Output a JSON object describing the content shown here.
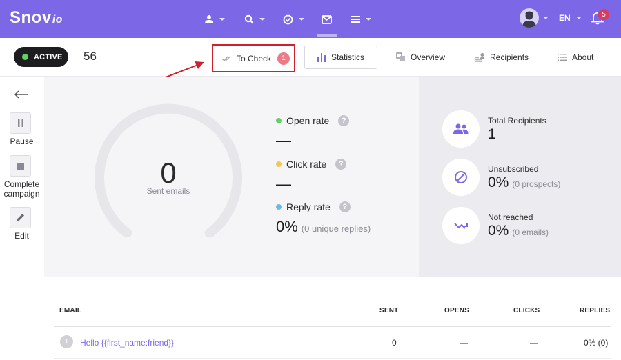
{
  "app": {
    "logo_main": "Snov",
    "logo_suffix": "io"
  },
  "topnav": {
    "items": [
      {
        "icon": "user-icon"
      },
      {
        "icon": "search-icon"
      },
      {
        "icon": "check-circle-icon"
      },
      {
        "icon": "mail-icon"
      },
      {
        "icon": "menu-icon"
      }
    ],
    "language": "EN",
    "notifications_count": "5"
  },
  "campaign": {
    "status": "ACTIVE",
    "name": "56"
  },
  "tabs": {
    "to_check": "To Check",
    "to_check_count": "1",
    "statistics": "Statistics",
    "overview": "Overview",
    "recipients": "Recipients",
    "about": "About"
  },
  "sidebar": {
    "pause": "Pause",
    "complete_line1": "Complete",
    "complete_line2": "campaign",
    "edit": "Edit"
  },
  "stats": {
    "sent_emails_value": "0",
    "sent_emails_label": "Sent emails",
    "open_rate_label": "Open rate",
    "open_rate_value": "—",
    "click_rate_label": "Click rate",
    "click_rate_value": "—",
    "reply_rate_label": "Reply rate",
    "reply_rate_value": "0%",
    "reply_rate_sub": "(0 unique replies)",
    "question_mark": "?",
    "colors": {
      "open": "#5fd35f",
      "click": "#f5c84b",
      "reply": "#6cb8e8"
    }
  },
  "recipients_stats": {
    "total_label": "Total Recipients",
    "total_value": "1",
    "unsub_label": "Unsubscribed",
    "unsub_value": "0%",
    "unsub_sub": "(0 prospects)",
    "notreached_label": "Not reached",
    "notreached_value": "0%",
    "notreached_sub": "(0 emails)"
  },
  "table": {
    "headers": {
      "email": "EMAIL",
      "sent": "SENT",
      "opens": "OPENS",
      "clicks": "CLICKS",
      "replies": "REPLIES"
    },
    "rows": [
      {
        "num": "1",
        "subject": "Hello {{first_name:friend}}",
        "sent": "0",
        "opens": "—",
        "clicks": "—",
        "replies": "0% (0)"
      }
    ]
  }
}
